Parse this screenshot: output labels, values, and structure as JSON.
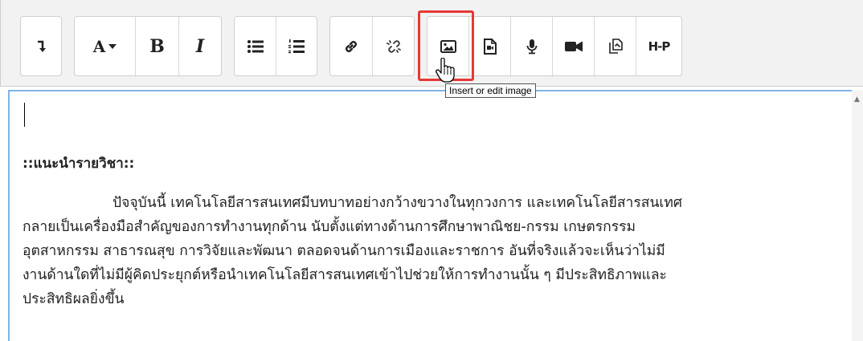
{
  "toolbar": {
    "buttons": {
      "collapse": "collapse-toggle-icon",
      "font_style_label": "A",
      "bold_label": "B",
      "italic_label": "I",
      "unordered_list": "unordered-list-icon",
      "ordered_list": "ordered-list-icon",
      "link": "link-icon",
      "unlink": "unlink-icon",
      "image": "image-icon",
      "media": "media-file-icon",
      "audio": "microphone-icon",
      "video": "video-camera-icon",
      "manage_files": "manage-files-icon",
      "h5p_label": "H-P"
    },
    "tooltip": "Insert or edit image"
  },
  "content": {
    "heading": "::แนะนำรายวิชา::",
    "paragraph_lines": [
      "ปัจจุบันนี้ เทคโนโลยีสารสนเทศมีบทบาทอย่างกว้างขวางในทุกวงการ และเทคโนโลยีสารสนเทศ",
      "กลายเป็นเครื่องมือสำคัญของการทำงานทุกด้าน นับตั้งแต่ทางด้านการศึกษาพาณิชย-กรรม เกษตรกรรม",
      "อุตสาหกรรม สาธารณสุข การวิจัยและพัฒนา ตลอดจนด้านการเมืองและราชการ อันที่จริงแล้วจะเห็นว่าไม่มี",
      "งานด้านใดที่ไม่มีผู้คิดประยุกต์หรือนำเทคโนโลยีสารสนเทศเข้าไปช่วยให้การทำงานนั้น ๆ มีประสิทธิภาพและ",
      "ประสิทธิผลยิ่งขึ้น"
    ]
  },
  "colors": {
    "highlight": "#e53935",
    "focus_border": "#7fb4e6",
    "toolbar_bg": "#f2f2f2"
  }
}
